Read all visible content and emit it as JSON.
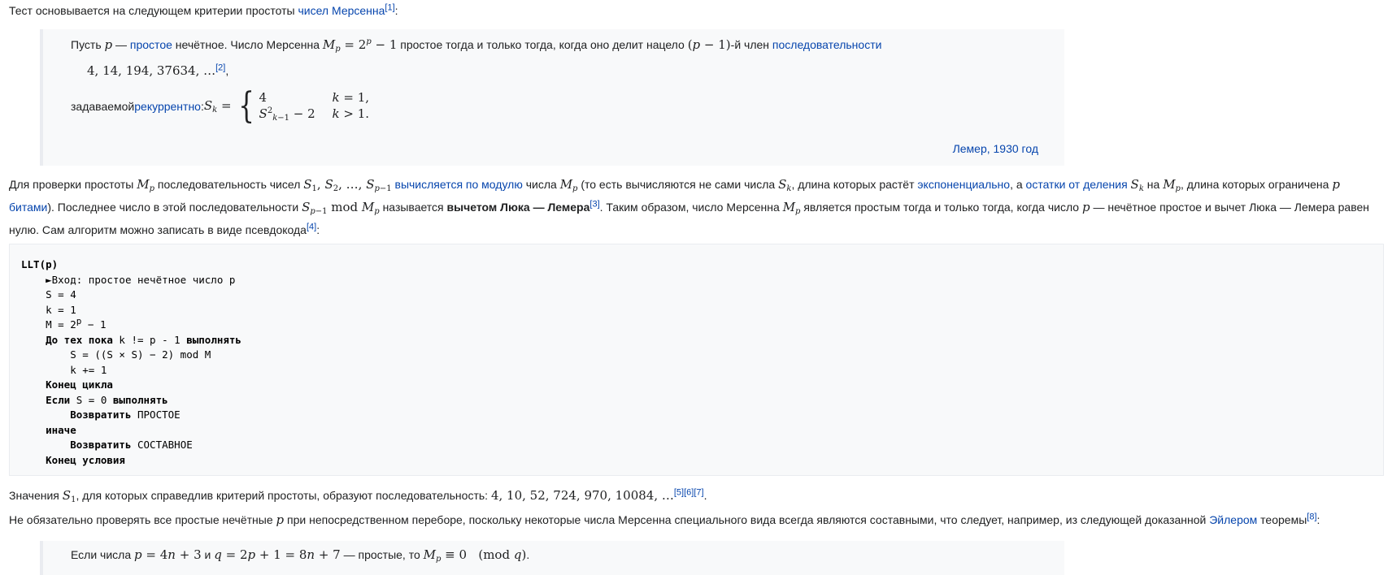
{
  "intro": {
    "text": "Тест основывается на следующем критерии простоты ",
    "link": "чисел Мерсенна",
    "ref": "[1]",
    "tail": ":"
  },
  "quote1": {
    "l1_a": "Пусть ",
    "l1_p": "p",
    "l1_dash": " — ",
    "l1_link1": "простое",
    "l1_b": " нечётное. Число Мерсенна ",
    "l1_formula": "M_p = 2^p − 1",
    "l1_c": " простое тогда и только тогда, когда оно делит нацело ",
    "l1_term": "(p − 1)",
    "l1_d": "-й член ",
    "l1_link2": "последовательности",
    "seq": "4, 14, 194, 37634, …",
    "seq_ref": "[2]",
    "seq_tail": ",",
    "rec_a": "задаваемой ",
    "rec_link": "рекуррентно",
    "rec_b": ": ",
    "case1_val": "4",
    "case1_cond": "k = 1,",
    "case2_val": "S²_{k−1} − 2",
    "case2_cond": "k > 1.",
    "attribution": "Лемер, 1930 год"
  },
  "para_check": {
    "a": "Для проверки простоты ",
    "b": " последовательность чисел ",
    "link1": "вычисляется по модулю",
    "c": " числа ",
    "d": " (то есть вычисляются не сами числа ",
    "e": ", длина которых растёт ",
    "link2": "экспоненциально",
    "f": ", а ",
    "link3": "остатки от деления",
    "g": " на ",
    "h": ", длина которых ограничена ",
    "link4": "битами",
    "i": "). Последнее число в этой последовательности ",
    "j": " называется ",
    "bold": "вычетом Люка — Лемера",
    "ref3": "[3]",
    "k": ". Таким образом, число Мерсенна ",
    "l": " является простым тогда и только тогда, когда число ",
    "m": " — нечётное простое и вычет Люка — Лемера равен нулю. Сам алгоритм можно записать в виде псевдокода",
    "ref4": "[4]",
    "n": ":"
  },
  "code": {
    "l1": "LLT(p)",
    "l2": "►Вход: простое нечётное число p",
    "l3": "S = 4",
    "l4": "k = 1",
    "l5a": "M = 2",
    "l5b": "p",
    "l5c": " − 1",
    "l6a": "До тех пока",
    "l6b": " k != p - 1 ",
    "l6c": "выполнять",
    "l7": "S = ((S × S) − 2) mod M",
    "l8": "k += 1",
    "l9": "Конец цикла",
    "l10a": "Если",
    "l10b": " S = 0 ",
    "l10c": "выполнять",
    "l11a": "Возвратить",
    "l11b": " ПРОСТОЕ",
    "l12": "иначе",
    "l13a": "Возвратить",
    "l13b": " СОСТАВНОЕ",
    "l14": "Конец условия"
  },
  "para_s1": {
    "a": "Значения ",
    "b": ", для которых справедлив критерий простоты, образуют последовательность: ",
    "seq": "4, 10, 52, 724, 970, 10084, …",
    "refs": "[5][6][7]",
    "tail": "."
  },
  "para_euler": {
    "a": "Не обязательно проверять все простые нечётные ",
    "b": " при непосредственном переборе, поскольку некоторые числа Мерсенна специального вида всегда являются составными, что следует, например, из следующей доказанной ",
    "link": "Эйлером",
    "c": " теоремы",
    "ref": "[8]",
    "tail": ":"
  },
  "quote2": {
    "a": "Если числа ",
    "f1": "p = 4n + 3",
    "b": " и ",
    "f2": "q = 2p + 1 = 8n + 7",
    "c": " — простые, то ",
    "f3": "M_p ≡ 0 (mod q)",
    "tail": "."
  }
}
